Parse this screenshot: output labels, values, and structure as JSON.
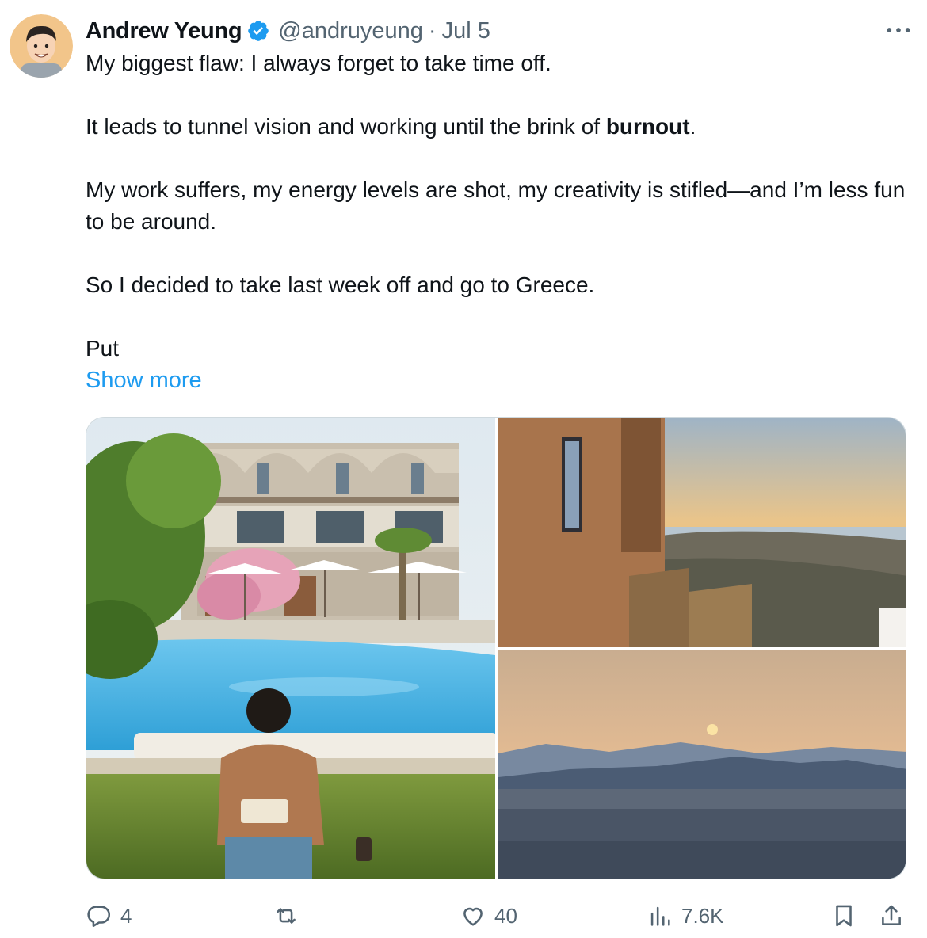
{
  "tweet": {
    "author": {
      "display_name": "Andrew Yeung",
      "handle": "@andruyeung",
      "verified": true,
      "avatar_icon": "avatar-cartoon"
    },
    "separator": "·",
    "date": "Jul 5",
    "text": {
      "p1": "My biggest flaw: I always forget to take time off.",
      "p2_before": "It leads to tunnel vision and working until the brink of ",
      "p2_bold": "burnout",
      "p2_after": ".",
      "p3": "My work suffers, my energy levels are shot, my creativity is stifled—and I’m less fun to be around.",
      "p4": "So I decided to take last week off and go to Greece.",
      "p5": "Put"
    },
    "show_more_label": "Show more",
    "media": [
      {
        "icon": "photo-pool-reading"
      },
      {
        "icon": "photo-sunset-building"
      },
      {
        "icon": "photo-sunset-city"
      }
    ],
    "stats": {
      "replies": "4",
      "retweets": "",
      "likes": "40",
      "views": "7.6K"
    }
  },
  "colors": {
    "text": "#0f1419",
    "secondary": "#536471",
    "link": "#1d9bf0",
    "verified": "#1d9bf0",
    "border": "#cfd9de"
  }
}
